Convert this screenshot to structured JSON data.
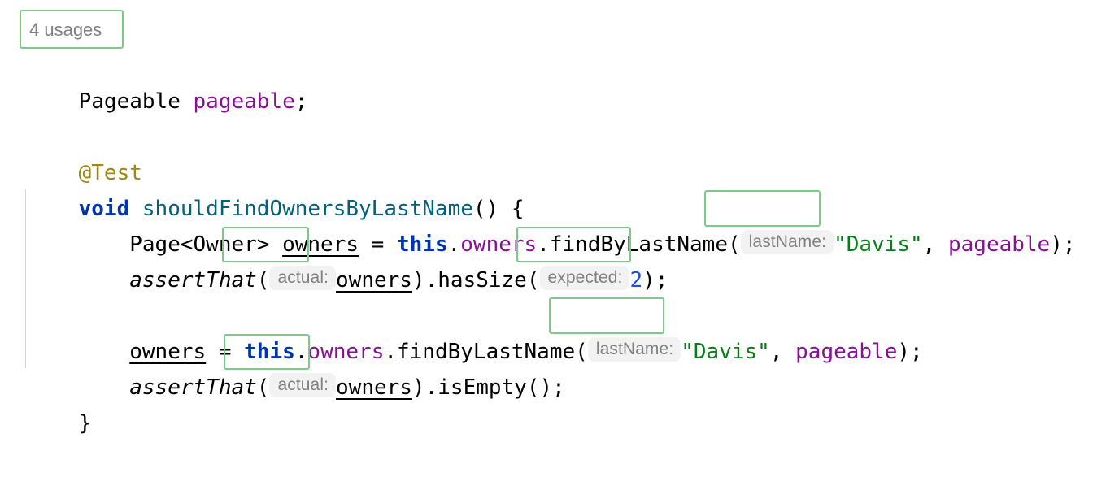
{
  "editor": {
    "language": "java",
    "background_color": "#ffffff",
    "font_size_px": 26,
    "line_height_px": 44,
    "indent_guide_color": "#d4d4d4",
    "annotation_border_color": "#7dc98a",
    "inlay_background_color": "#f2f2f2",
    "inlay_text_color": "#808080"
  },
  "palette": {
    "default": "#000000",
    "keyword": "#0033b3",
    "field": "#871094",
    "annotation": "#9e880d",
    "method_declaration": "#00627a",
    "string": "#067d17",
    "number": "#1750eb"
  },
  "usages_hint": {
    "label": "4 usages"
  },
  "code": {
    "line1": {
      "type": "Pageable",
      "name": "pageable",
      "semi": ";"
    },
    "line_annotation": {
      "text": "@Test"
    },
    "line_signature": {
      "keyword": "void",
      "space": " ",
      "method": "shouldFindOwnersByLastName",
      "tail": "() {"
    },
    "line_find1": {
      "indent": "    ",
      "type": "Page<Owner>",
      "sp1": " ",
      "var": "owners",
      "assign": " = ",
      "this": "this",
      "dot1": ".",
      "field": "owners",
      "dot2": ".",
      "call": "findByLastName",
      "paren_open": "(",
      "hint": "lastName:",
      "string": "\"Davis\"",
      "comma": ", ",
      "arg": "pageable",
      "tail": ");"
    },
    "line_assert1": {
      "indent": "    ",
      "assert": "assertThat",
      "paren_open": "(",
      "hint": "actual:",
      "var": "owners",
      "mid": ").hasSize(",
      "hint2": "expected:",
      "number": "2",
      "tail": ");"
    },
    "line_find2": {
      "indent": "    ",
      "var": "owners",
      "assign": " = ",
      "this": "this",
      "dot1": ".",
      "field": "owners",
      "dot2": ".",
      "call": "findByLastName",
      "paren_open": "(",
      "hint": "lastName:",
      "string": "\"Davis\"",
      "comma": ", ",
      "arg": "pageable",
      "tail": ");"
    },
    "line_assert2": {
      "indent": "    ",
      "assert": "assertThat",
      "paren_open": "(",
      "hint": "actual:",
      "var": "owners",
      "tail": ").isEmpty();"
    },
    "line_close": {
      "brace": "}"
    }
  },
  "annotations": [
    {
      "name": "usages-hint-box",
      "label": "4 usages"
    },
    {
      "name": "lastname-hint-box-1",
      "label": "lastName:"
    },
    {
      "name": "actual-hint-box-1",
      "label": "actual:"
    },
    {
      "name": "expected-hint-box",
      "label": "expected:"
    },
    {
      "name": "lastname-hint-box-2",
      "label": "lastName:"
    },
    {
      "name": "actual-hint-box-2",
      "label": "actual:"
    }
  ]
}
